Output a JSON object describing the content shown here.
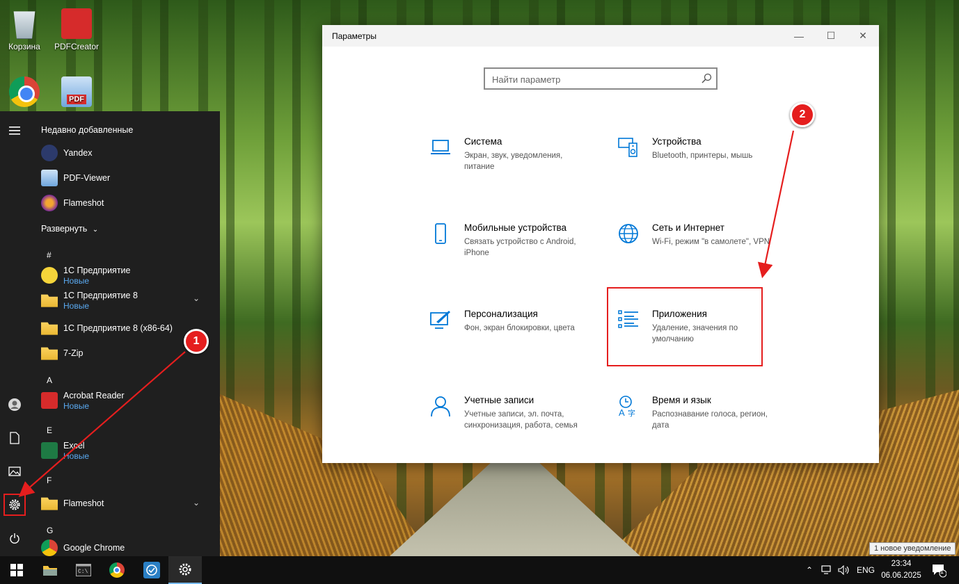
{
  "desktop": {
    "icons": [
      {
        "label": "Корзина",
        "icon": "recycle-bin-icon"
      },
      {
        "label": "PDFCreator",
        "icon": "pdfcreator-icon"
      },
      {
        "label": "",
        "icon": "chrome-icon"
      },
      {
        "label": "",
        "icon": "pdf-viewer-icon"
      }
    ]
  },
  "start_menu": {
    "recently_added_title": "Недавно добавленные",
    "recent": [
      {
        "name": "Yandex",
        "icon": "yandex-icon"
      },
      {
        "name": "PDF-Viewer",
        "icon": "pdf-viewer-icon"
      },
      {
        "name": "Flameshot",
        "icon": "flameshot-icon"
      }
    ],
    "expand_label": "Развернуть",
    "groups": [
      {
        "letter": "#"
      },
      {
        "letter": "A"
      },
      {
        "letter": "E"
      },
      {
        "letter": "F"
      },
      {
        "letter": "G"
      }
    ],
    "apps": [
      {
        "name": "1С Предприятие",
        "sub": "Новые"
      },
      {
        "name": "1С Предприятие 8",
        "sub": "Новые"
      },
      {
        "name": "1С Предприятие 8 (x86-64)",
        "sub": ""
      },
      {
        "name": "7-Zip",
        "sub": ""
      },
      {
        "name": "Acrobat Reader",
        "sub": "Новые"
      },
      {
        "name": "Excel",
        "sub": "Новые"
      },
      {
        "name": "Flameshot",
        "sub": ""
      },
      {
        "name": "Google Chrome",
        "sub": ""
      }
    ],
    "rail": [
      "hamburger-icon",
      "user-icon",
      "document-icon",
      "pictures-icon",
      "settings-gear-icon",
      "power-icon"
    ]
  },
  "settings": {
    "window_title": "Параметры",
    "controls": {
      "minimize": "—",
      "maximize": "☐",
      "close": "✕"
    },
    "search_placeholder": "Найти параметр",
    "categories": [
      {
        "name": "Система",
        "desc": "Экран, звук, уведомления, питание",
        "icon": "laptop-icon"
      },
      {
        "name": "Устройства",
        "desc": "Bluetooth, принтеры, мышь",
        "icon": "devices-icon"
      },
      {
        "name": "Мобильные устройства",
        "desc": "Связать устройство с Android, iPhone",
        "icon": "phone-icon"
      },
      {
        "name": "Сеть и Интернет",
        "desc": "Wi-Fi, режим \"в самолете\", VPN",
        "icon": "globe-icon"
      },
      {
        "name": "Персонализация",
        "desc": "Фон, экран блокировки, цвета",
        "icon": "personalization-icon"
      },
      {
        "name": "Приложения",
        "desc": "Удаление, значения по умолчанию",
        "icon": "apps-list-icon"
      },
      {
        "name": "Учетные записи",
        "desc": "Учетные записи, эл. почта, синхронизация, работа, семья",
        "icon": "person-icon"
      },
      {
        "name": "Время и язык",
        "desc": "Распознавание голоса, регион, дата",
        "icon": "time-language-icon"
      }
    ]
  },
  "annotations": {
    "step1": "1",
    "step2": "2",
    "color": "#e51e1e"
  },
  "taskbar": {
    "apps": [
      "windows-start-icon",
      "file-explorer-icon",
      "terminal-icon",
      "chrome-icon",
      "network-tool-icon",
      "settings-gear-icon"
    ],
    "language": "ENG",
    "time": "23:34",
    "date": "06.06.2025",
    "notification_count": "1",
    "notification_tooltip": "1 новое уведомление"
  },
  "colors": {
    "accent": "#0078d7",
    "start_bg": "#1f1f1f",
    "taskbar_bg": "#101010",
    "new_badge": "#5aa9f0"
  }
}
